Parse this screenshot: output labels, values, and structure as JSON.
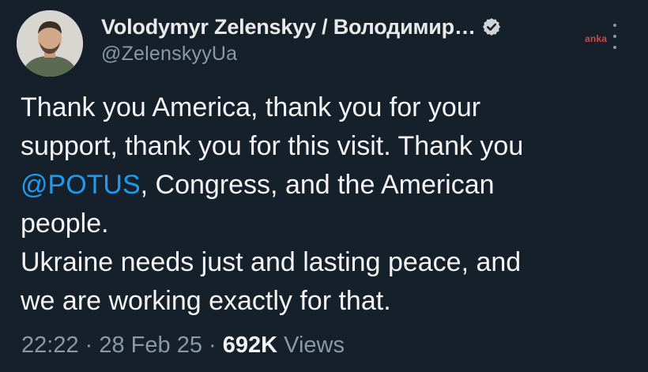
{
  "author": {
    "display_name": "Volodymyr Zelenskyy / Володимир…",
    "handle": "@ZelenskyyUa",
    "verified": true
  },
  "watermark": "anka",
  "tweet": {
    "line1": "Thank you America, thank you for your",
    "line2": "support, thank you for this visit. Thank you",
    "mention": "@POTUS",
    "line3_rest": ", Congress, and the American",
    "line4": "people.",
    "line5": "Ukraine needs just and lasting peace, and",
    "line6": "we are working exactly for that."
  },
  "meta": {
    "time": "22:22",
    "sep1": " · ",
    "date": "28 Feb 25",
    "sep2": " · ",
    "views_count": "692K",
    "views_label": " Views"
  },
  "colors": {
    "background": "#15202b",
    "accent": "#1d9bf0",
    "text": "#e7e9ea",
    "muted": "#8b98a5"
  },
  "icons": {
    "verified": "verified-badge-icon",
    "more": "more-options-icon"
  }
}
